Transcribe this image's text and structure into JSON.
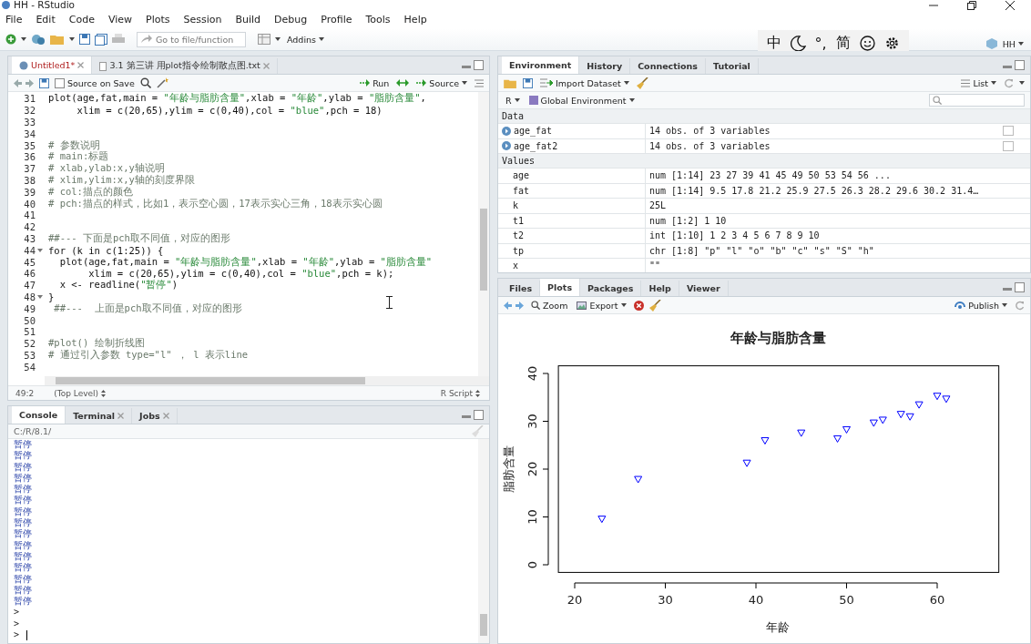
{
  "window": {
    "title": "HH - RStudio"
  },
  "menu": [
    "File",
    "Edit",
    "Code",
    "View",
    "Plots",
    "Session",
    "Build",
    "Debug",
    "Profile",
    "Tools",
    "Help"
  ],
  "toolbar": {
    "goto_placeholder": "Go to file/function",
    "addins": "Addins",
    "user": "HH"
  },
  "ime_bar": [
    {
      "kind": "text",
      "label": "中"
    },
    {
      "kind": "moon"
    },
    {
      "kind": "text",
      "label": "°,"
    },
    {
      "kind": "text",
      "label": "简"
    },
    {
      "kind": "smile"
    },
    {
      "kind": "gear"
    }
  ],
  "editor": {
    "tabs": [
      {
        "label": "Untitled1*",
        "selected": true
      },
      {
        "label": "3.1 第三讲 用plot指令绘制散点图.txt",
        "selected": false
      }
    ],
    "source_on_save": {
      "label": "Source on Save",
      "checked": false
    },
    "run": "Run",
    "source": "Source",
    "lines": [
      {
        "number": "31",
        "kind": "code",
        "code": "plot(age,fat,main = \"年龄与脂肪含量\",xlab = \"年龄\",ylab = \"脂肪含量\","
      },
      {
        "number": "32",
        "kind": "code",
        "code": "     xlim = c(20,65),ylim = c(0,40),col = \"blue\",pch = 18)"
      },
      {
        "number": "33"
      },
      {
        "number": "34"
      },
      {
        "number": "35",
        "kind": "comment",
        "code": "# 参数说明"
      },
      {
        "number": "36",
        "kind": "comment",
        "code": "# main:标题"
      },
      {
        "number": "37",
        "kind": "comment",
        "code": "# xlab,ylab:x,y轴说明"
      },
      {
        "number": "38",
        "kind": "comment",
        "code": "# xlim,ylim:x,y轴的刻度界限"
      },
      {
        "number": "39",
        "kind": "comment",
        "code": "# col:描点的颜色"
      },
      {
        "number": "40",
        "kind": "comment",
        "code": "# pch:描点的样式，比如1，表示空心圆，17表示实心三角，18表示实心圆"
      },
      {
        "number": "41"
      },
      {
        "number": "42"
      },
      {
        "number": "43",
        "kind": "comment",
        "code": "##--- 下面是pch取不同值，对应的图形"
      },
      {
        "number": "44",
        "kind": "code",
        "code": "for (k in c(1:25)) {",
        "fold": true
      },
      {
        "number": "45",
        "kind": "code",
        "code": "  plot(age,fat,main = \"年龄与脂肪含量\",xlab = \"年龄\",ylab = \"脂肪含量\""
      },
      {
        "number": "46",
        "kind": "code",
        "code": "       xlim = c(20,65),ylim = c(0,40),col = \"blue\",pch = k);"
      },
      {
        "number": "47",
        "kind": "code",
        "code": "  x <- readline(\"暂停\")"
      },
      {
        "number": "48",
        "kind": "code",
        "code": "}",
        "fold": true
      },
      {
        "number": "49",
        "kind": "comment",
        "code": " ##---  上面是pch取不同值，对应的图形"
      },
      {
        "number": "50"
      },
      {
        "number": "51"
      },
      {
        "number": "52",
        "kind": "comment",
        "code": "#plot() 绘制折线图"
      },
      {
        "number": "53",
        "kind": "comment",
        "code": "# 通过引入参数 type=\"l\" ， l 表示line"
      },
      {
        "number": "54"
      }
    ],
    "status": {
      "position": "49:2",
      "scope": "(Top Level)",
      "file_type": "R Script"
    }
  },
  "console": {
    "tabs": [
      {
        "label": "Console",
        "selected": true,
        "closable": false
      },
      {
        "label": "Terminal",
        "selected": false,
        "closable": true
      },
      {
        "label": "Jobs",
        "selected": false,
        "closable": true
      }
    ],
    "path": "C:/R/8.1/",
    "output": [
      {
        "kind": "output",
        "text": "暂停"
      },
      {
        "kind": "output",
        "text": "暂停"
      },
      {
        "kind": "output",
        "text": "暂停"
      },
      {
        "kind": "output",
        "text": "暂停"
      },
      {
        "kind": "output",
        "text": "暂停"
      },
      {
        "kind": "output",
        "text": "暂停"
      },
      {
        "kind": "output",
        "text": "暂停"
      },
      {
        "kind": "output",
        "text": "暂停"
      },
      {
        "kind": "output",
        "text": "暂停"
      },
      {
        "kind": "output",
        "text": "暂停"
      },
      {
        "kind": "output",
        "text": "暂停"
      },
      {
        "kind": "output",
        "text": "暂停"
      },
      {
        "kind": "output",
        "text": "暂停"
      },
      {
        "kind": "output",
        "text": "暂停"
      },
      {
        "kind": "output",
        "text": "暂停"
      },
      {
        "kind": "prompt",
        "text": ">",
        "cursor": false
      },
      {
        "kind": "prompt",
        "text": ">",
        "cursor": false
      },
      {
        "kind": "prompt",
        "text": ">",
        "cursor": true
      }
    ]
  },
  "environment": {
    "tabs": [
      {
        "label": "Environment",
        "selected": true
      },
      {
        "label": "History",
        "selected": false
      },
      {
        "label": "Connections",
        "selected": false
      },
      {
        "label": "Tutorial",
        "selected": false
      }
    ],
    "import": "Import Dataset",
    "view": "List",
    "language": "R",
    "scope": "Global Environment",
    "sections": [
      {
        "title": "Data",
        "rows": [
          {
            "kind": "data",
            "name": "age_fat",
            "value": "14 obs. of 3 variables"
          },
          {
            "kind": "data",
            "name": "age_fat2",
            "value": "14 obs. of 3 variables"
          }
        ]
      },
      {
        "title": "Values",
        "rows": [
          {
            "kind": "value",
            "name": "age",
            "value": "num [1:14] 23 27 39 41 45 49 50 53 54 56 ..."
          },
          {
            "kind": "value",
            "name": "fat",
            "value": "num [1:14] 9.5 17.8 21.2 25.9 27.5 26.3 28.2 29.6 30.2 31.4…"
          },
          {
            "kind": "value",
            "name": "k",
            "value": "25L"
          },
          {
            "kind": "value",
            "name": "t1",
            "value": "num [1:2] 1 10"
          },
          {
            "kind": "value",
            "name": "t2",
            "value": "int [1:10] 1 2 3 4 5 6 7 8 9 10"
          },
          {
            "kind": "value",
            "name": "tp",
            "value": "chr [1:8] \"p\" \"l\" \"o\" \"b\" \"c\" \"s\" \"S\" \"h\""
          },
          {
            "kind": "value",
            "name": "x",
            "value": "\"\""
          }
        ]
      }
    ]
  },
  "plots": {
    "tabs": [
      {
        "label": "Files",
        "selected": false
      },
      {
        "label": "Plots",
        "selected": true
      },
      {
        "label": "Packages",
        "selected": false
      },
      {
        "label": "Help",
        "selected": false
      },
      {
        "label": "Viewer",
        "selected": false
      }
    ],
    "zoom": "Zoom",
    "export": "Export",
    "publish": "Publish",
    "chart_data": {
      "type": "scatter",
      "title": "年龄与脂肪含量",
      "xlabel": "年龄",
      "ylabel": "脂肪含量",
      "xlim": [
        18.2,
        66.8
      ],
      "ylim": [
        -1.6,
        41.6
      ],
      "xticks": [
        20,
        30,
        40,
        50,
        60
      ],
      "yticks": [
        0,
        10,
        20,
        30,
        40
      ],
      "x": [
        23,
        27,
        39,
        41,
        45,
        49,
        50,
        53,
        54,
        56,
        57,
        58,
        60,
        61
      ],
      "series": [
        {
          "color": "#0000ff",
          "values": [
            9.5,
            17.8,
            21.2,
            25.9,
            27.5,
            26.3,
            28.2,
            29.6,
            30.2,
            31.4,
            30.9,
            33.4,
            35.2,
            34.6
          ]
        }
      ]
    }
  }
}
